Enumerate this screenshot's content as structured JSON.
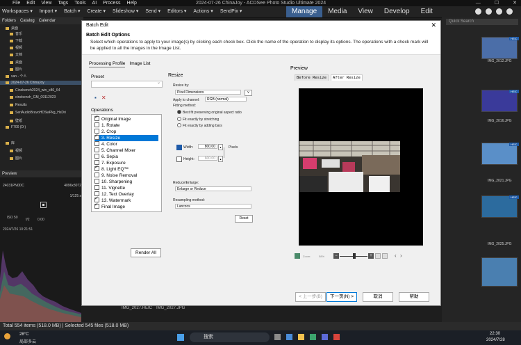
{
  "app": {
    "window_title": "2024-07-26 ChinaJoy - ACDSee Photo Studio Ultimate 2024",
    "menu": [
      "File",
      "Edit",
      "View",
      "Tags",
      "Tools",
      "AI",
      "Process",
      "Help"
    ],
    "toolbar": [
      "Workspaces ▾",
      "Import ▾",
      "Batch ▾",
      "Create ▾",
      "Slideshow ▾",
      "Send ▾",
      "Editors ▾",
      "Actions ▾",
      "SendPix ▾"
    ],
    "modes": [
      "Manage",
      "Media",
      "View",
      "Develop",
      "Edit"
    ],
    "active_mode": "Manage",
    "left_tabs": [
      "Folders",
      "Catalog",
      "Calendar"
    ],
    "folders": [
      "桌面",
      "音乐",
      "下载",
      "视频",
      "文档",
      "桌面",
      "图片",
      "van - 个人",
      "2024-07-26 ChinaJoy",
      "Cinebench2024_win_x86_64",
      "cinebench_GM_09112023",
      "Results",
      "SeriAudioBravoHDSwPkg_HsDri",
      "壁纸",
      "F700 (D:)",
      "库",
      "视频",
      "图片"
    ],
    "selected_folder": "2024-07-26 ChinaJoy",
    "preview_title": "Preview",
    "preview_meta": {
      "name": "24031PN0DC",
      "res": "4096x3072",
      "exposure": "1/125 s",
      "iso": "ISO 50",
      "aperture": "f/2",
      "ev": "0.00",
      "date": "2024/7/26 10:21:51"
    },
    "search_placeholder": "Quick Search",
    "thumbnails": [
      {
        "label": "IMG_2012.JPG",
        "badge": "HEIC",
        "color": "#4b6ea8"
      },
      {
        "label": "IMG_2016.JPG",
        "badge": "HEIC",
        "color": "#3a3a9a"
      },
      {
        "label": "IMG_2021.JPG",
        "badge": "HEIC",
        "color": "#5a8fc8"
      },
      {
        "label": "IMG_2025.JPG",
        "badge": "HEIC",
        "color": "#2c6b9e"
      }
    ],
    "filmstrip": [
      "IMG_2027.HEIC",
      "IMG_2027.JPG"
    ],
    "status": "Total 554 items  (518.0 MB)  |  Selected 545 files (518.0 MB)",
    "taskbar": {
      "weather_temp": "28°C",
      "weather_text": "局部多云",
      "search": "搜索",
      "time": "22:30",
      "date": "2024/7/28"
    }
  },
  "dialog": {
    "title": "Batch Edit",
    "heading": "Batch Edit Options",
    "description": "Select which operations to apply to your image(s) by clicking each check box. Click the name of the operation to display its options. The operations with a check mark will be applied to all the images in the Image List.",
    "tabs": [
      "Processing Profile",
      "Image List"
    ],
    "preset_label": "Preset",
    "operations_label": "Operations",
    "operations": [
      {
        "label": "Original Image",
        "checked": true
      },
      {
        "label": "1. Rotate",
        "checked": false
      },
      {
        "label": "2. Crop",
        "checked": false
      },
      {
        "label": "3. Resize",
        "checked": true,
        "selected": true
      },
      {
        "label": "4. Color",
        "checked": false
      },
      {
        "label": "5. Channel Mixer",
        "checked": false
      },
      {
        "label": "6. Sepia",
        "checked": false
      },
      {
        "label": "7. Exposure",
        "checked": false
      },
      {
        "label": "8. Light EQ™",
        "checked": true
      },
      {
        "label": "9. Noise Removal",
        "checked": false
      },
      {
        "label": "10. Sharpening",
        "checked": false
      },
      {
        "label": "11. Vignette",
        "checked": false
      },
      {
        "label": "12. Text Overlay",
        "checked": false
      },
      {
        "label": "13. Watermark",
        "checked": true
      },
      {
        "label": "Final Image",
        "checked": true
      }
    ],
    "render_all": "Render All",
    "resize": {
      "title": "Resize",
      "resize_by_label": "Resize by:",
      "resize_by": "Pixel Dimensions",
      "channel_label": "Apply to channel:",
      "channel": "RGB (normal)",
      "fitting_label": "Fitting method:",
      "fit_options": [
        "Best fit preserving original aspect ratio",
        "Fit exactly by stretching",
        "Fit exactly by adding bars"
      ],
      "width_label": "Width:",
      "width": "800.00",
      "height_label": "Height:",
      "height": "600.00",
      "units": "Pixels",
      "reduce_label": "Reduce/Enlarge:",
      "reduce": "Enlarge or Reduce",
      "resample_label": "Resampling method:",
      "resample": "Lanczos",
      "reset": "Reset"
    },
    "preview_label": "Preview",
    "preview_tabs": [
      "Before Resize",
      "After Resize"
    ],
    "zoom_label": "Zoom:",
    "zoom_value": "58%",
    "buttons": {
      "back": "< 上一步(B)",
      "next": "下一页(N) >",
      "cancel": "取消",
      "help": "帮助"
    }
  }
}
